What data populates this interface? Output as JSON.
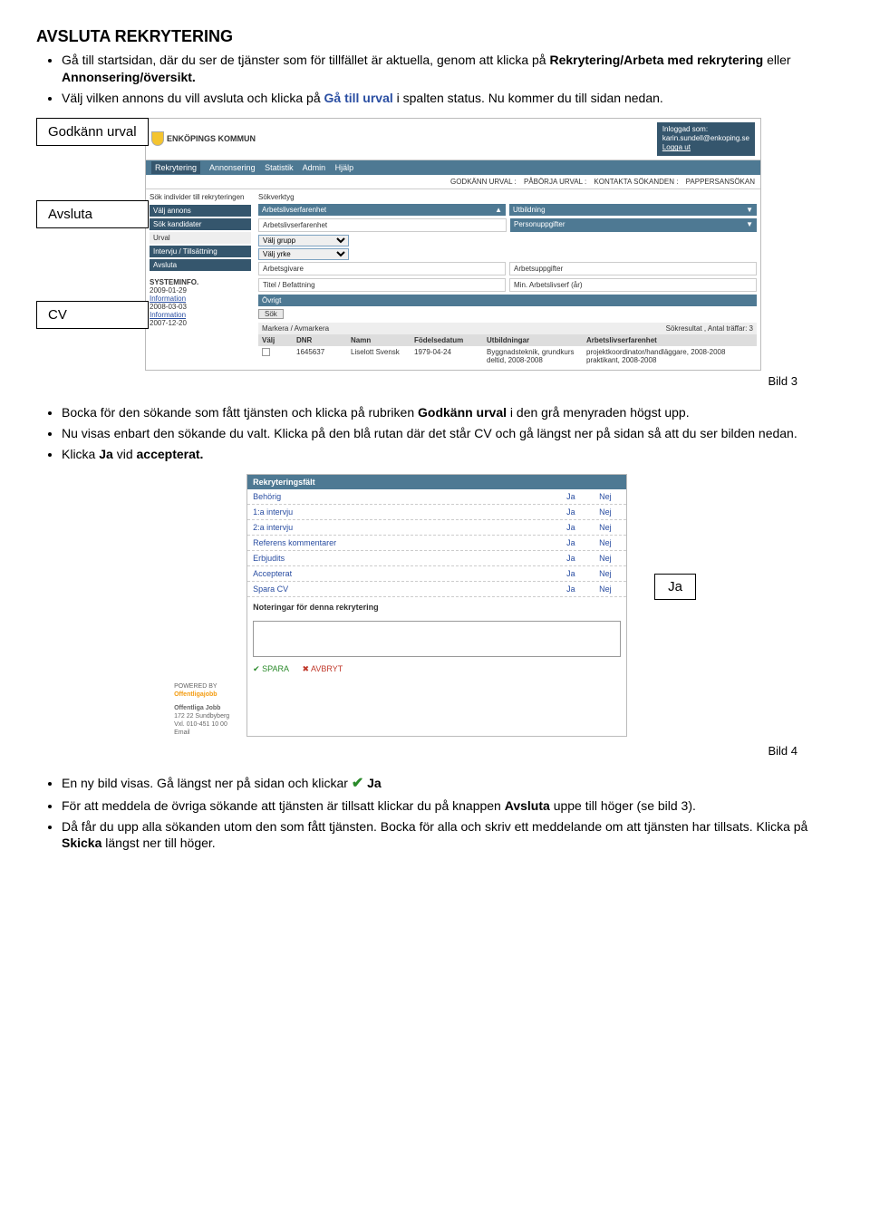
{
  "title": "AVSLUTA REKRYTERING",
  "intro": {
    "b1_a": "Gå till startsidan, där du ser de tjänster som för tillfället är aktuella, genom att klicka på ",
    "b1_b": "Rekrytering/Arbeta med rekrytering",
    "b1_c": " eller ",
    "b1_d": "Annonsering/översikt.",
    "b2_a": "Välj vilken annons du vill avsluta och klicka på ",
    "b2_b": "Gå till urval",
    "b2_c": " i spalten status. Nu kommer du till sidan nedan."
  },
  "callouts": {
    "godkann": "Godkänn urval",
    "avsluta": "Avsluta",
    "cv": "CV",
    "ja": "Ja"
  },
  "mock3": {
    "brand": "ENKÖPINGS KOMMUN",
    "login_label": "Inloggad som:",
    "login_user": "karin.sundell@enkoping.se",
    "logout": "Logga ut",
    "nav": [
      "Rekrytering",
      "Annonsering",
      "Statistik",
      "Admin",
      "Hjälp"
    ],
    "submenu": [
      "GODKÄNN URVAL",
      "PÅBÖRJA URVAL",
      "KONTAKTA SÖKANDEN",
      "PAPPERSANSÖKAN"
    ],
    "left_title": "Sök individer till rekryteringen",
    "left_items": [
      "Välj annons",
      "Sök kandidater",
      "Urval",
      "Intervju / Tillsättning",
      "Avsluta"
    ],
    "sysinfo_label": "SYSTEMINFO.",
    "sysinfo1_date": "2009-01-29",
    "sysinfo1_link": "Information",
    "sysinfo2_date": "2008-03-03",
    "sysinfo2_link": "Information",
    "sysinfo3_date": "2007-12-20",
    "sokverktyg": "Sökverktyg",
    "filter_arb": "Arbetslivserfarenhet",
    "filter_utb": "Utbildning",
    "filter_arb_sub": "Arbetslivserfarenhet",
    "filter_pers": "Personuppgifter",
    "valj_grupp": "Välj grupp",
    "valj_yrke": "Välj yrke",
    "arbgiv": "Arbetsgivare",
    "arbupp": "Arbetsuppgifter",
    "titel": "Titel / Befattning",
    "minar": "Min. Arbetslivserf (år)",
    "ovrigt": "Övrigt",
    "sok": "Sök",
    "markera": "Markera / Avmarkera",
    "result_label": "Sökresultat , Antal träffar: 3",
    "th": [
      "Välj",
      "DNR",
      "Namn",
      "Födelsedatum",
      "Utbildningar",
      "Arbetslivserfarenhet"
    ],
    "row_dnr": "1645637",
    "row_name": "Liselott Svensk",
    "row_dob": "1979-04-24",
    "row_utb": "Byggnadsteknik, grundkurs deltid, 2008-2008",
    "row_arb": "projektkoordinator/handläggare, 2008-2008 praktikant, 2008-2008"
  },
  "bild3": "Bild 3",
  "mid_bullets": {
    "b1_a": "Bocka för den sökande som fått tjänsten och klicka på rubriken ",
    "b1_b": "Godkänn urval",
    "b1_c": " i den grå menyraden högst upp.",
    "b2": "Nu visas enbart den sökande du valt. Klicka på den blå rutan där det står CV och gå längst ner på sidan så att du ser bilden nedan.",
    "b3_a": "Klicka ",
    "b3_b": "Ja",
    "b3_c": " vid ",
    "b3_d": "accepterat."
  },
  "mock4": {
    "header": "Rekryteringsfält",
    "rows": [
      {
        "label": "Behörig",
        "ja": "Ja",
        "nej": "Nej"
      },
      {
        "label": "1:a intervju",
        "ja": "Ja",
        "nej": "Nej"
      },
      {
        "label": "2:a intervju",
        "ja": "Ja",
        "nej": "Nej"
      },
      {
        "label": "Referens kommentarer",
        "ja": "Ja",
        "nej": "Nej"
      },
      {
        "label": "Erbjudits",
        "ja": "Ja",
        "nej": "Nej"
      },
      {
        "label": "Accepterat",
        "ja": "Ja",
        "nej": "Nej"
      },
      {
        "label": "Spara CV",
        "ja": "Ja",
        "nej": "Nej"
      }
    ],
    "notes": "Noteringar för denna rekrytering",
    "powered": "POWERED BY",
    "ofj": "Offentligajobb",
    "ofj2": "Offentliga Jobb",
    "addr": "172 22 Sundbyberg",
    "tel": "Vxl. 010-451 10 00",
    "email": "Email",
    "spara": "SPARA",
    "avbryt": "AVBRYT"
  },
  "bild4": "Bild 4",
  "end_bullets": {
    "b1_a": "En ny bild visas. Gå längst ner på sidan och klickar ",
    "b1_b": "Ja",
    "b2_a": "För att meddela de övriga sökande att tjänsten är tillsatt klickar du på knappen ",
    "b2_b": "Avsluta",
    "b2_c": " uppe till höger (se bild 3).",
    "b3_a": "Då får du upp alla sökanden utom den som fått tjänsten. Bocka för alla och skriv ett meddelande om att tjänsten har tillsats. Klicka på ",
    "b3_b": "Skicka",
    "b3_c": " längst ner till höger."
  },
  "chart_data": null
}
